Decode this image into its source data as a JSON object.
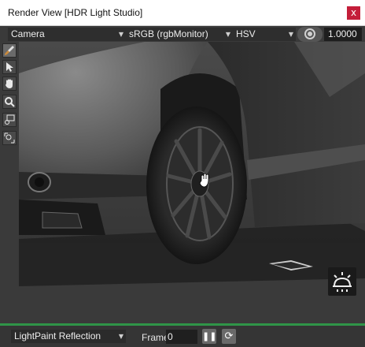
{
  "window": {
    "title": "Render View [HDR Light Studio]",
    "close_glyph": "x"
  },
  "toolbar": {
    "camera": "Camera",
    "colorspace": "sRGB (rgbMonitor)",
    "colormode": "HSV",
    "exposure_icon": "aperture-icon",
    "value": "1.0000"
  },
  "tools": [
    "brush-icon",
    "pointer-icon",
    "hand-icon",
    "zoom-icon",
    "zoom-region-icon",
    "zoom-fit-icon"
  ],
  "bottom": {
    "mode": "LightPaint Reflection",
    "frame_label": "Frame",
    "frame_value": "0",
    "pause_icon": "pause-icon",
    "refresh_icon": "refresh-icon"
  },
  "colors": {
    "status": "#2f9448",
    "close": "#c41e3a"
  }
}
